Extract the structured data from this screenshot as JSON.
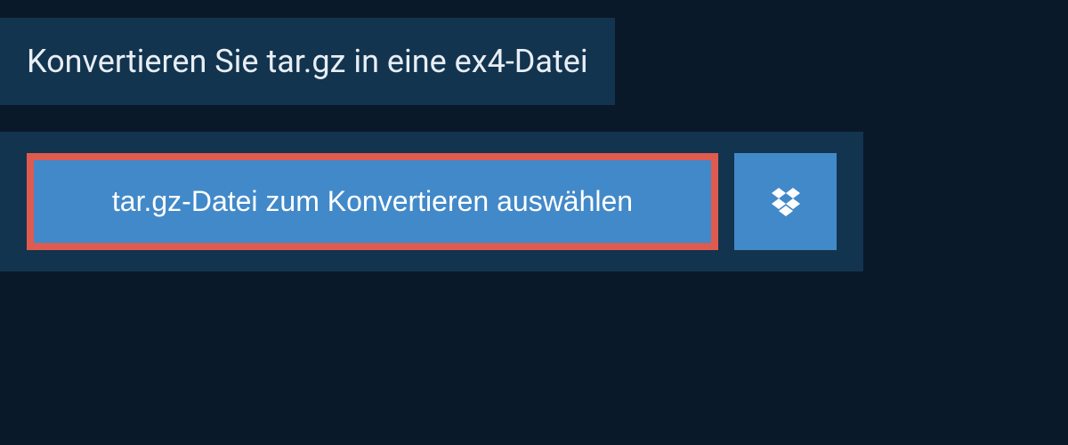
{
  "header": {
    "title": "Konvertieren Sie tar.gz in eine ex4-Datei"
  },
  "upload": {
    "select_file_label": "tar.gz-Datei zum Konvertieren auswählen"
  }
}
